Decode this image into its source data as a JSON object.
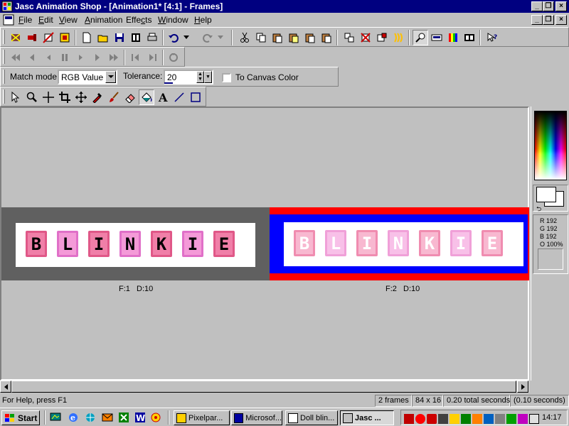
{
  "window": {
    "title": "Jasc Animation Shop - [Animation1* [4:1] - Frames]"
  },
  "menubar": {
    "items": [
      {
        "pre": "",
        "key": "F",
        "post": "ile"
      },
      {
        "pre": "",
        "key": "E",
        "post": "dit"
      },
      {
        "pre": "",
        "key": "V",
        "post": "iew"
      },
      {
        "pre": "",
        "key": "A",
        "post": "nimation"
      },
      {
        "pre": "Effe",
        "key": "c",
        "post": "ts"
      },
      {
        "pre": "",
        "key": "W",
        "post": "indow"
      },
      {
        "pre": "",
        "key": "H",
        "post": "elp"
      }
    ]
  },
  "options_bar": {
    "match_mode_label": "Match mode:",
    "match_mode_value": "RGB Value",
    "tolerance_label": "Tolerance:",
    "tolerance_value": "20",
    "canvas_color_label": "To Canvas Color"
  },
  "frames": [
    {
      "label": "F:1",
      "delay": "D:10",
      "letters": [
        "B",
        "L",
        "I",
        "N",
        "K",
        "I",
        "E"
      ]
    },
    {
      "label": "F:2",
      "delay": "D:10",
      "letters": [
        "B",
        "L",
        "I",
        "N",
        "K",
        "I",
        "E"
      ]
    }
  ],
  "palette": {
    "r": "R 192",
    "g": "G 192",
    "b": "B 192",
    "o": "O 100%"
  },
  "statusbar": {
    "help": "For Help, press F1",
    "frames": "2 frames",
    "size": "84 x 16",
    "total": "0.20 total seconds",
    "frame_time": "(0.10 seconds)"
  },
  "taskbar": {
    "start": "Start",
    "tasks": [
      "Pixelpar...",
      "Microsof...",
      "Doll blin...",
      "Jasc ..."
    ],
    "clock": "14:17"
  },
  "colors": {
    "titlebar": "#000080",
    "frame1_border": "#606060",
    "frame2_outer": "#ff0000",
    "frame2_inner": "#0000ff",
    "tile_pink": "#f07fa8",
    "tile_light": "#f8b8d0"
  }
}
